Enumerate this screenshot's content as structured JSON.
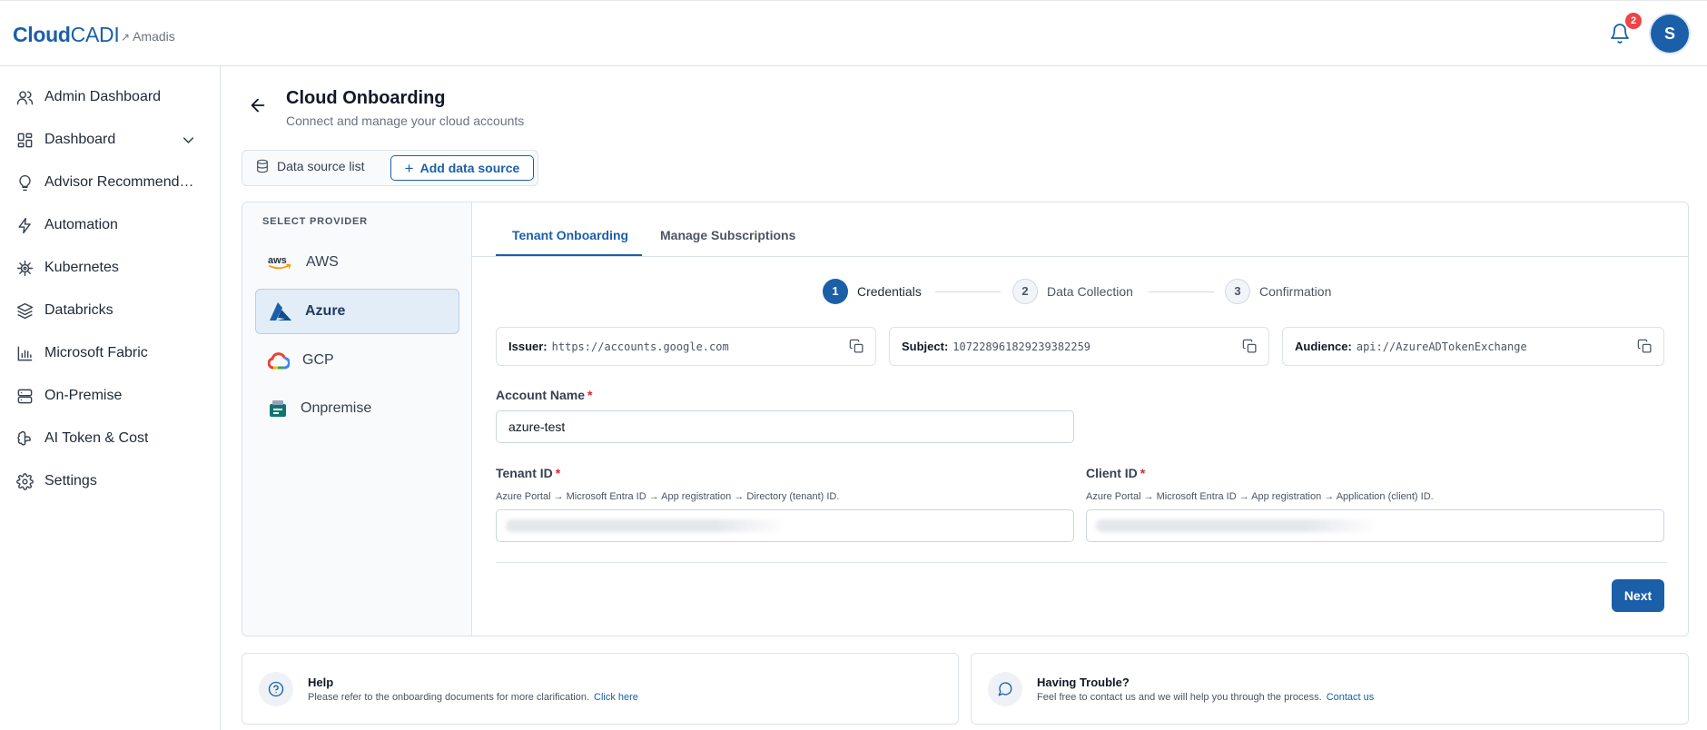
{
  "brand": {
    "logo_bold": "Cloud",
    "logo_light": "CADI",
    "tenant": "Amadis"
  },
  "header": {
    "notification_count": "2",
    "avatar_initial": "S"
  },
  "sidebar": {
    "items": [
      {
        "label": "Admin Dashboard",
        "icon": "users-icon"
      },
      {
        "label": "Dashboard",
        "icon": "dashboard-icon"
      },
      {
        "label": "Advisor Recommendations",
        "icon": "lightbulb-icon"
      },
      {
        "label": "Automation",
        "icon": "bolt-icon"
      },
      {
        "label": "Kubernetes",
        "icon": "helm-icon"
      },
      {
        "label": "Databricks",
        "icon": "layers-icon"
      },
      {
        "label": "Microsoft Fabric",
        "icon": "bar-chart-icon"
      },
      {
        "label": "On-Premise",
        "icon": "server-icon"
      },
      {
        "label": "AI Token & Cost",
        "icon": "brain-icon"
      },
      {
        "label": "Settings",
        "icon": "gear-icon"
      }
    ]
  },
  "page": {
    "title": "Cloud Onboarding",
    "subtitle": "Connect and manage your cloud accounts"
  },
  "datasource_tabs": {
    "list_label": "Data source list",
    "add_label": "Add data source"
  },
  "provider_panel": {
    "heading": "SELECT PROVIDER",
    "providers": [
      {
        "label": "AWS"
      },
      {
        "label": "Azure"
      },
      {
        "label": "GCP"
      },
      {
        "label": "Onpremise"
      }
    ],
    "selected": "Azure"
  },
  "tabs": {
    "tenant": "Tenant Onboarding",
    "subscriptions": "Manage Subscriptions"
  },
  "steps": [
    {
      "num": "1",
      "label": "Credentials"
    },
    {
      "num": "2",
      "label": "Data Collection"
    },
    {
      "num": "3",
      "label": "Confirmation"
    }
  ],
  "federated": {
    "issuer": {
      "key": "Issuer:",
      "value": "https://accounts.google.com"
    },
    "subject": {
      "key": "Subject:",
      "value": "107228961829239382259"
    },
    "audience": {
      "key": "Audience:",
      "value": "api://AzureADTokenExchange"
    }
  },
  "form": {
    "account_name": {
      "label": "Account Name",
      "value": "azure-test"
    },
    "tenant_id": {
      "label": "Tenant ID",
      "help": "Azure Portal → Microsoft Entra ID → App registration → Directory (tenant) ID."
    },
    "client_id": {
      "label": "Client ID",
      "help": "Azure Portal → Microsoft Entra ID → App registration → Application (client) ID."
    },
    "required_mark": "*",
    "next_label": "Next"
  },
  "help": {
    "title": "Help",
    "text": "Please refer to the onboarding documents for more clarification.",
    "link": "Click here"
  },
  "trouble": {
    "title": "Having Trouble?",
    "text": "Feel free to contact us and we will help you through the process.",
    "link": "Contact us"
  },
  "colors": {
    "accent": "#1b5fa8",
    "badge": "#ef4444",
    "required": "#dc2626"
  }
}
